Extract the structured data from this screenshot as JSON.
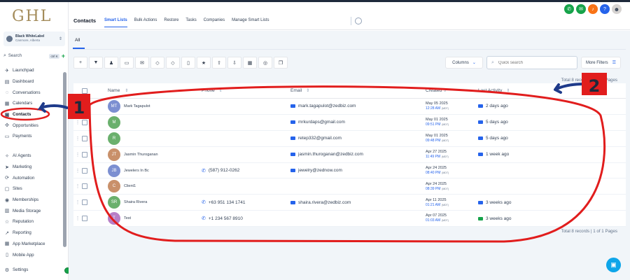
{
  "sidebar": {
    "logo": "GHL",
    "account": {
      "name": "Black WhiteLabel",
      "location": "Canmore, Alberta"
    },
    "search": {
      "label": "Search",
      "shortcut": "ctrl K"
    },
    "items_top": [
      {
        "label": "Launchpad",
        "icon": "rocket-icon"
      },
      {
        "label": "Dashboard",
        "icon": "dashboard-icon"
      },
      {
        "label": "Conversations",
        "icon": "chat-icon"
      },
      {
        "label": "Calendars",
        "icon": "calendar-icon"
      },
      {
        "label": "Contacts",
        "icon": "contacts-icon"
      },
      {
        "label": "Opportunities",
        "icon": "opportunities-icon"
      },
      {
        "label": "Payments",
        "icon": "payments-icon"
      }
    ],
    "items_bottom": [
      {
        "label": "AI Agents",
        "icon": "ai-icon"
      },
      {
        "label": "Marketing",
        "icon": "send-icon"
      },
      {
        "label": "Automation",
        "icon": "automation-icon"
      },
      {
        "label": "Sites",
        "icon": "sites-icon"
      },
      {
        "label": "Memberships",
        "icon": "memberships-icon"
      },
      {
        "label": "Media Storage",
        "icon": "media-icon"
      },
      {
        "label": "Reputation",
        "icon": "reputation-icon"
      },
      {
        "label": "Reporting",
        "icon": "reporting-icon"
      },
      {
        "label": "App Marketplace",
        "icon": "marketplace-icon"
      },
      {
        "label": "Mobile App",
        "icon": "mobile-icon"
      }
    ],
    "settings": "Settings"
  },
  "header": {
    "title": "Contacts",
    "tabs": [
      "Smart Lists",
      "Bulk Actions",
      "Restore",
      "Tasks",
      "Companies",
      "Manage Smart Lists"
    ]
  },
  "content": {
    "tab_all": "All",
    "columns_label": "Columns",
    "search_placeholder": "Quick search",
    "more_filters": "More Filters",
    "total_bottom": "Total 8 records | 1 of 1 Pages",
    "total_top": "Total 8 records | 1 of 1 Pages"
  },
  "table": {
    "headers": {
      "name": "Name",
      "phone": "Phone",
      "email": "Email",
      "created": "Created",
      "last_activity": "Last Activity"
    },
    "rows": [
      {
        "initials": "MT",
        "color": "#7c8fd1",
        "name": "Mark Tagapulot",
        "phone": "",
        "email": "mark.tagapulot@zedbiz.com",
        "date": "May 05 2025",
        "time": "12:28 AM",
        "tz": "(MDT)",
        "activity": "2 days ago",
        "activity_icon": "mail"
      },
      {
        "initials": "M",
        "color": "#6ab06d",
        "name": "",
        "phone": "",
        "email": "mrkurdaps@gmail.com",
        "date": "May 01 2025",
        "time": "09:51 PM",
        "tz": "(MDT)",
        "activity": "5 days ago",
        "activity_icon": "mail"
      },
      {
        "initials": "R",
        "color": "#6ab06d",
        "name": "",
        "phone": "",
        "email": "retep332@gmail.com",
        "date": "May 01 2025",
        "time": "09:48 PM",
        "tz": "(MDT)",
        "activity": "5 days ago",
        "activity_icon": "mail"
      },
      {
        "initials": "JT",
        "color": "#c9906a",
        "name": "Jasmin Thuroganan",
        "phone": "",
        "email": "jasmin.thuroganan@zedbiz.com",
        "date": "Apr 27 2025",
        "time": "11:49 PM",
        "tz": "(MDT)",
        "activity": "1 week ago",
        "activity_icon": "mail"
      },
      {
        "initials": "JB",
        "color": "#7c8fd1",
        "name": "Jewelers In Bc",
        "phone": "(587) 912-0262",
        "email": "jewelry@zednow.com",
        "date": "Apr 24 2025",
        "time": "08:40 PM",
        "tz": "(MDT)",
        "activity": "",
        "activity_icon": ""
      },
      {
        "initials": "C",
        "color": "#c9906a",
        "name": "Client1",
        "phone": "",
        "email": "",
        "date": "Apr 24 2025",
        "time": "08:39 PM",
        "tz": "(MDT)",
        "activity": "",
        "activity_icon": ""
      },
      {
        "initials": "SR",
        "color": "#6ab06d",
        "name": "Shaira Rivera",
        "phone": "+63 951 134 1741",
        "email": "shaira.rivera@zedbiz.com",
        "date": "Apr 11 2025",
        "time": "01:21 AM",
        "tz": "(MDT)",
        "activity": "3 weeks ago",
        "activity_icon": "mail"
      },
      {
        "initials": "T",
        "color": "#b77fc7",
        "name": "Test",
        "phone": "+1 234 567 8910",
        "email": "",
        "date": "Apr 07 2025",
        "time": "01:03 AM",
        "tz": "(MDT)",
        "activity": "3 weeks ago",
        "activity_icon": "chat"
      }
    ]
  },
  "annotations": {
    "label_1": "1",
    "label_2": "2",
    "color": "#e11d1d"
  },
  "colors": {
    "accent": "#2563eb",
    "logo": "#a38b5a"
  }
}
